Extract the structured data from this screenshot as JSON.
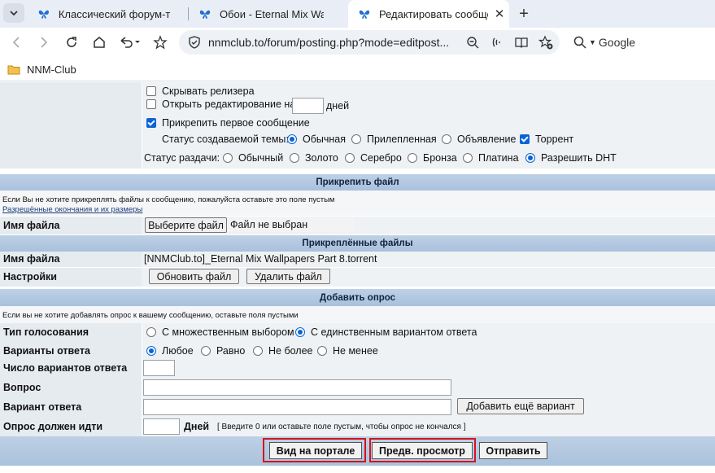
{
  "browser": {
    "tabs": [
      {
        "label": "Классический форум-т",
        "active": false
      },
      {
        "label": "Обои - Eternal Mix Wall",
        "active": false
      },
      {
        "label": "Редактировать сообще",
        "active": true
      }
    ],
    "url": "nnmclub.to/forum/posting.php?mode=editpost...",
    "search_placeholder": "Google",
    "bookmark_label": "NNM-Club"
  },
  "options": {
    "hide_releaser": "Скрывать релизера",
    "open_edit_for": "Открыть редактирование на",
    "open_edit_days_suffix": "дней",
    "pin_first_post": "Прикрепить первое сообщение",
    "topic_status_label": "Статус создаваемой темы:",
    "topic_status_options": [
      "Обычная",
      "Прилепленная",
      "Объявление"
    ],
    "torrent_label": "Торрент",
    "release_status_label": "Статус раздачи:",
    "release_status_options": [
      "Обычный",
      "Золото",
      "Серебро",
      "Бронза",
      "Платина"
    ],
    "dht_label": "Разрешить DHT"
  },
  "attach": {
    "header": "Прикрепить файл",
    "hint": "Если Вы не хотите прикреплять файлы к сообщению, пожалуйста оставьте это поле пустым",
    "allowed_link": "Разрешённые окончания и их размеры",
    "filename_label": "Имя файла",
    "choose_button": "Выберите файл",
    "no_file_text": "Файл не выбран"
  },
  "attached": {
    "header": "Прикреплённые файлы",
    "filename_label": "Имя файла",
    "filename_value": "[NNMClub.to]_Eternal Mix Wallpapers Part 8.torrent",
    "settings_label": "Настройки",
    "update_button": "Обновить файл",
    "delete_button": "Удалить файл"
  },
  "poll": {
    "header": "Добавить опрос",
    "hint": "Если вы не хотите добавлять опрос к вашему сообщению, оставьте поля пустыми",
    "vote_type_label": "Тип голосования",
    "vote_type_options": [
      "С множественным выбором",
      "С единственным вариантом ответа"
    ],
    "answers_label": "Варианты ответа",
    "answers_options": [
      "Любое",
      "Равно",
      "Не более",
      "Не менее"
    ],
    "answer_count_label": "Число вариантов ответа",
    "question_label": "Вопрос",
    "option_label": "Вариант ответа",
    "add_option_button": "Добавить ещё вариант",
    "duration_label": "Опрос должен идти",
    "duration_days": "Дней",
    "duration_hint": "[ Введите 0 или оставьте поле пустым, чтобы опрос не кончался ]"
  },
  "submit": {
    "portal_view": "Вид на портале",
    "preview": "Предв. просмотр",
    "send": "Отправить"
  },
  "colors": {
    "highlight": "#d3141c",
    "accent": "#0b63d8"
  }
}
